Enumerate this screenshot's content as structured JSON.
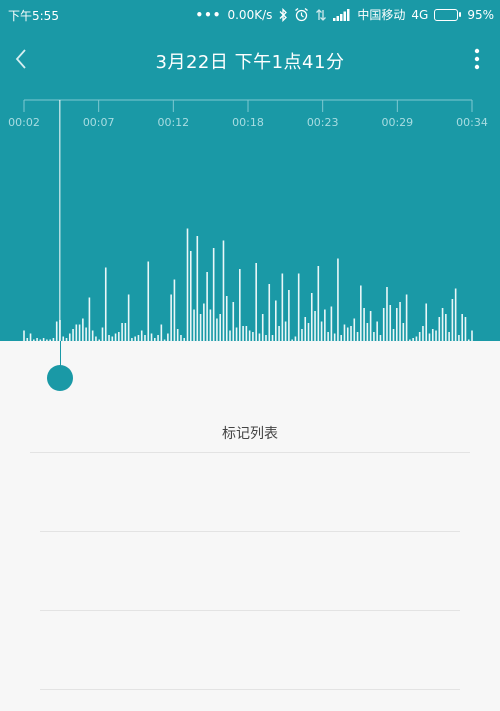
{
  "status_bar": {
    "time": "下午5:55",
    "dots": "•••",
    "network_speed": "0.00K/s",
    "carrier": "中国移动",
    "network": "4G",
    "battery_percent": "95%",
    "battery_level": 0.95
  },
  "header": {
    "title": "3月22日 下午1点41分"
  },
  "timeline": {
    "ticks": [
      "00:02",
      "00:07",
      "00:12",
      "00:18",
      "00:23",
      "00:29",
      "00:34"
    ],
    "playhead_position": 0.08
  },
  "waveform": {
    "levels": [
      0.07,
      0.02,
      0.05,
      0.01,
      0.02,
      0.01,
      0.02,
      0.01,
      0.01,
      0.02,
      0.13,
      0.14,
      0.03,
      0.02,
      0.05,
      0.08,
      0.11,
      0.11,
      0.15,
      0.09,
      0.29,
      0.07,
      0.03,
      0.01,
      0.09,
      0.49,
      0.04,
      0.03,
      0.05,
      0.06,
      0.12,
      0.12,
      0.31,
      0.02,
      0.03,
      0.04,
      0.07,
      0.04,
      0.53,
      0.05,
      0.02,
      0.04,
      0.11,
      0.01,
      0.05,
      0.31,
      0.41,
      0.08,
      0.04,
      0.02,
      0.75,
      0.6,
      0.21,
      0.7,
      0.18,
      0.25,
      0.46,
      0.21,
      0.62,
      0.15,
      0.18,
      0.67,
      0.3,
      0.07,
      0.26,
      0.09,
      0.48,
      0.1,
      0.1,
      0.07,
      0.06,
      0.52,
      0.05,
      0.18,
      0.04,
      0.38,
      0.04,
      0.27,
      0.1,
      0.45,
      0.13,
      0.34,
      0.01,
      0.03,
      0.45,
      0.08,
      0.16,
      0.12,
      0.32,
      0.2,
      0.5,
      0.13,
      0.21,
      0.06,
      0.23,
      0.05,
      0.55,
      0.04,
      0.11,
      0.09,
      0.1,
      0.15,
      0.06,
      0.37,
      0.22,
      0.12,
      0.2,
      0.06,
      0.13,
      0.04,
      0.22,
      0.36,
      0.24,
      0.08,
      0.22,
      0.26,
      0.12,
      0.31,
      0.01,
      0.02,
      0.03,
      0.06,
      0.1,
      0.25,
      0.05,
      0.08,
      0.07,
      0.16,
      0.22,
      0.18,
      0.06,
      0.28,
      0.35,
      0.04,
      0.18,
      0.16,
      0.01,
      0.07
    ]
  },
  "marks": {
    "title": "标记列表"
  },
  "icons": {
    "back": "back-icon",
    "more": "more-icon",
    "bluetooth": "bluetooth-icon",
    "alarm": "alarm-icon",
    "data_arrows": "data-arrows-icon",
    "signal": "signal-icon",
    "battery": "battery-icon"
  },
  "colors": {
    "accent": "#1a99a6",
    "waveform": "#eaf7f8",
    "background": "#f7f7f7"
  }
}
